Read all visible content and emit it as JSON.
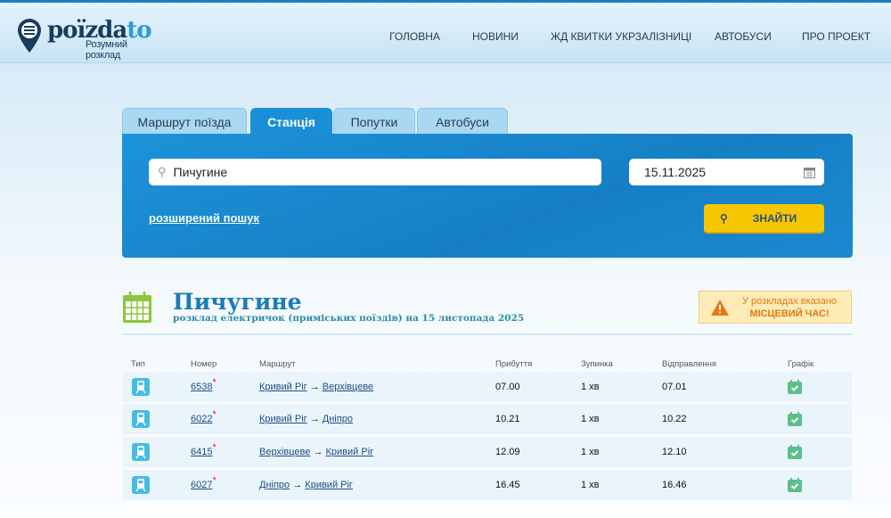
{
  "header": {
    "logo_main": "poïzda",
    "logo_accent": "to",
    "logo_sub": "Розумний розклад",
    "nav": [
      "ГОЛОВНА",
      "НОВИНИ",
      "ЖД КВИТКИ УКРЗАЛІЗНИЦІ",
      "АВТОБУСИ",
      "ПРО ПРОЕКТ"
    ]
  },
  "search": {
    "tabs": [
      "Маршрут поїзда",
      "Станція",
      "Попутки",
      "Автобуси"
    ],
    "active_tab": "Станція",
    "station_value": "Пичугине",
    "date_value": "15.11.2025",
    "advanced_link": "розширений пошук",
    "find_button": "ЗНАЙТИ"
  },
  "station": {
    "title": "Пичугине",
    "subtitle": "розклад електричок (приміських поїздів) на 15 листопада 2025"
  },
  "warning": {
    "line1": "У розкладах вказано",
    "line2": "МІСЦЕВИЙ ЧАС!"
  },
  "table": {
    "headers": [
      "Тип",
      "Номер",
      "Маршрут",
      "Прибуття",
      "Зупинка",
      "Відправлення",
      "Графік"
    ],
    "rows": [
      {
        "number": "6538",
        "from": "Кривий Ріг",
        "to": "Верхівцеве",
        "arrival": "07.00",
        "stop": "1 хв",
        "departure": "07.01"
      },
      {
        "number": "6022",
        "from": "Кривий Ріг",
        "to": "Дніпро",
        "arrival": "10.21",
        "stop": "1 хв",
        "departure": "10.22"
      },
      {
        "number": "6415",
        "from": "Верхівцеве",
        "to": "Кривий Ріг",
        "arrival": "12.09",
        "stop": "1 хв",
        "departure": "12.10"
      },
      {
        "number": "6027",
        "from": "Дніпро",
        "to": "Кривий Ріг",
        "arrival": "16.45",
        "stop": "1 хв",
        "departure": "16.46"
      }
    ],
    "arrow": "→",
    "star": "*"
  },
  "colors": {
    "accent": "#1a8fd6",
    "button": "#f6c600",
    "title": "#1a7bb6"
  }
}
